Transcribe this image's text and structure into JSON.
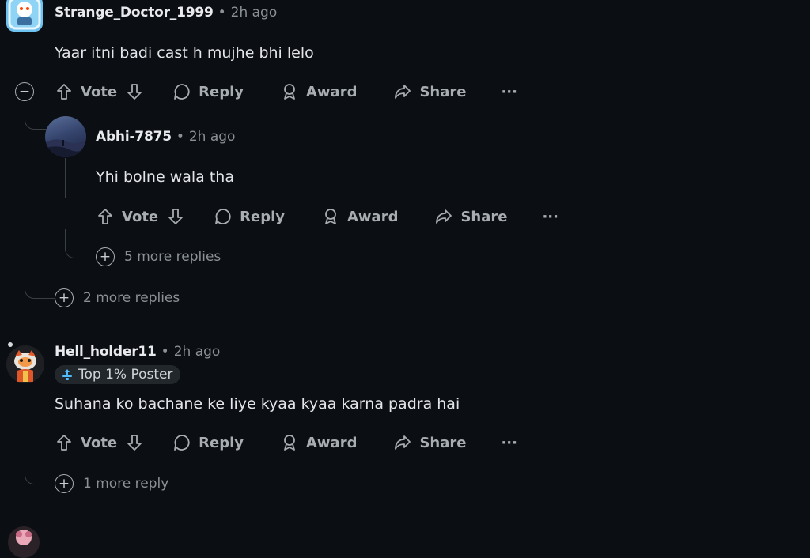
{
  "comments": [
    {
      "user": "Strange_Doctor_1999",
      "time": "2h ago",
      "text": "Yaar itni badi cast h mujhe bhi lelo",
      "more_replies": "2 more replies"
    },
    {
      "user": "Abhi-7875",
      "time": "2h ago",
      "text": "Yhi bolne wala tha",
      "more_replies": "5 more replies"
    },
    {
      "user": "Hell_holder11",
      "time": "2h ago",
      "badge": "Top 1% Poster",
      "text": "Suhana ko bachane ke liye kyaa kyaa karna padra hai",
      "more_replies": "1 more reply"
    }
  ],
  "actions": {
    "vote": "Vote",
    "reply": "Reply",
    "award": "Award",
    "share": "Share",
    "more": "···"
  },
  "separator": "•",
  "collapse_symbol": "−",
  "expand_symbol": "+"
}
